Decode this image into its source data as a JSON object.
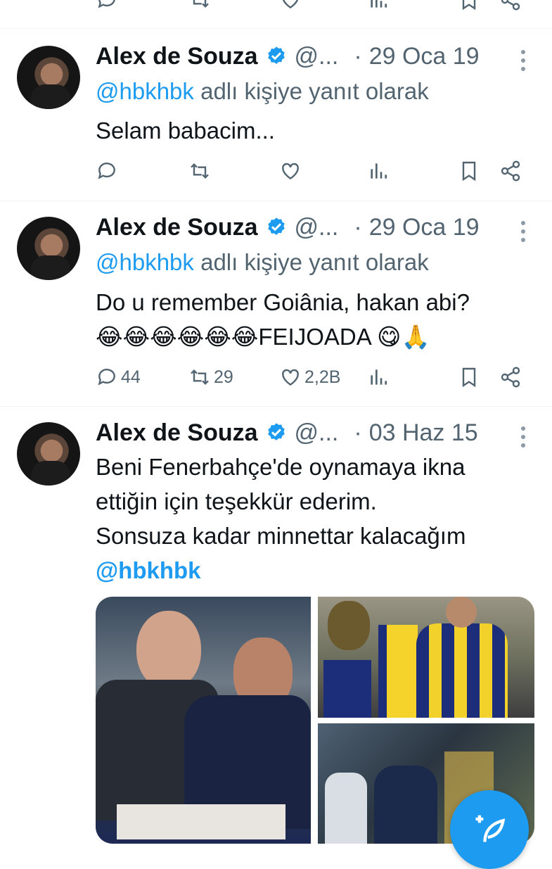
{
  "tweets": [
    {
      "name": "Alex de Souza",
      "handle": "@...",
      "separator": "·",
      "date": "29 Oca 19",
      "reply_to": "@hbkhbk",
      "reply_suffix": "adlı kişiye yanıt olarak",
      "text_lines": [
        "Selam babacim..."
      ],
      "stats": {
        "replies": "",
        "retweets": "",
        "likes": ""
      }
    },
    {
      "name": "Alex de Souza",
      "handle": "@...",
      "separator": "·",
      "date": "29 Oca 19",
      "reply_to": "@hbkhbk",
      "reply_suffix": "adlı kişiye yanıt olarak",
      "text_lines": [
        "Do u remember Goiânia, hakan abi?",
        "😂😂😂😂😂😂FEIJOADA 😋🙏"
      ],
      "stats": {
        "replies": "44",
        "retweets": "29",
        "likes": "2,2B"
      }
    },
    {
      "name": "Alex de Souza",
      "handle": "@...",
      "separator": "·",
      "date": "03 Haz 15",
      "text_lines": [
        "Beni Fenerbahçe'de oynamaya ikna",
        "ettiğin için teşekkür ederim.",
        "Sonsuza kadar minnettar kalacağım",
        "@hbkhbk"
      ],
      "stats": {
        "replies": "",
        "retweets": "",
        "likes": ""
      }
    }
  ],
  "colors": {
    "accent": "#1d9bf0",
    "secondary": "#536471",
    "text": "#0f1419"
  },
  "icons": [
    "reply-icon",
    "retweet-icon",
    "like-icon",
    "views-icon",
    "bookmark-icon",
    "share-icon",
    "verified-icon",
    "more-icon",
    "compose-icon"
  ]
}
